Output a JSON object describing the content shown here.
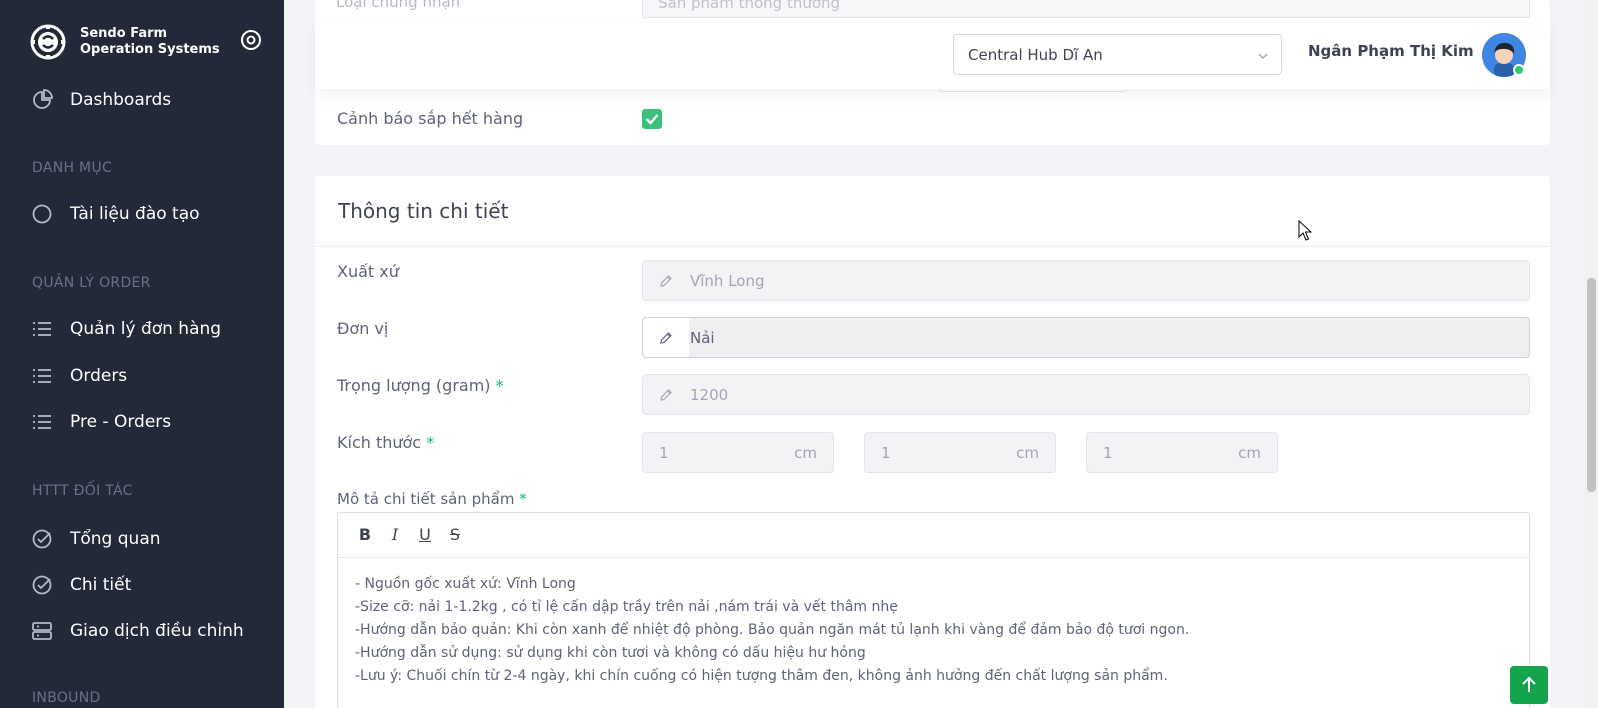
{
  "brand": {
    "line1": "Sendo Farm",
    "line2": "Operation Systems"
  },
  "sidebar": {
    "dashboards": "Dashboards",
    "section_danh_muc": "DANH MỤC",
    "tai_lieu": "Tài liệu đào tạo",
    "section_quan_ly_order": "QUẢN LÝ ORDER",
    "quan_ly_don_hang": "Quản lý đơn hàng",
    "orders": "Orders",
    "pre_orders": "Pre - Orders",
    "section_httt": "HTTT ĐỐI TÁC",
    "tong_quan": "Tổng quan",
    "chi_tiet": "Chi tiết",
    "giao_dich": "Giao dịch điều chỉnh",
    "section_inbound": "INBOUND"
  },
  "header": {
    "hub": "Central Hub Dĩ An",
    "user": "Ngân Phạm Thị Kim"
  },
  "card1": {
    "ghost_label": "Loại chứng nhận",
    "ghost_value": "Sản phẩm thông thường",
    "canh_bao_label": "Cảnh báo sắp hết hàng",
    "canh_bao_checked": true
  },
  "details": {
    "title": "Thông tin chi tiết",
    "xuat_xu_label": "Xuất xứ",
    "xuat_xu_value": "Vĩnh Long",
    "don_vi_label": "Đơn vị",
    "don_vi_value": "Nải",
    "trong_luong_label": "Trọng lượng (gram)",
    "trong_luong_value": "1200",
    "kich_thuoc_label": "Kích thước",
    "dim1": "1",
    "dim2": "1",
    "dim3": "1",
    "unit": "cm",
    "mo_ta_label": "Mô tả chi tiết sản phẩm",
    "required_mark": "*",
    "toolbar": {
      "bold": "B",
      "italic": "I",
      "underline": "U",
      "strike": "S"
    },
    "description": [
      "- Nguồn gốc xuất xứ: Vĩnh Long",
      "-Size cỡ: nải 1-1.2kg , có tỉ lệ cấn dập trầy trên nải ,nám trái và vết thâm nhẹ",
      "-Hướng dẫn bảo quản: Khi còn xanh để nhiệt độ phòng. Bảo quản ngăn mát tủ lạnh khi vàng để đảm bảo độ tươi ngon.",
      "-Hướng dẫn sử dụng: sử dụng khi còn tươi và không có dấu hiệu hư hỏng",
      "-Lưu ý: Chuối chín từ 2-4 ngày, khi chín cuống có hiện tượng thâm đen, không ảnh hưởng đến chất lượng sản phẩm."
    ]
  },
  "colors": {
    "sidebar_bg": "#242939",
    "accent_green": "#14a44d",
    "required": "#0bb783"
  },
  "icons": {
    "logo": "sendo-logo-icon",
    "toggle": "sidebar-toggle-icon",
    "dashboards": "pie-chart-icon",
    "circle": "circle-icon",
    "list": "list-icon",
    "check": "check-circle-icon",
    "server": "server-icon",
    "pen": "pen-icon",
    "chevron": "chevron-down-icon",
    "arrow_up": "arrow-up-icon"
  }
}
